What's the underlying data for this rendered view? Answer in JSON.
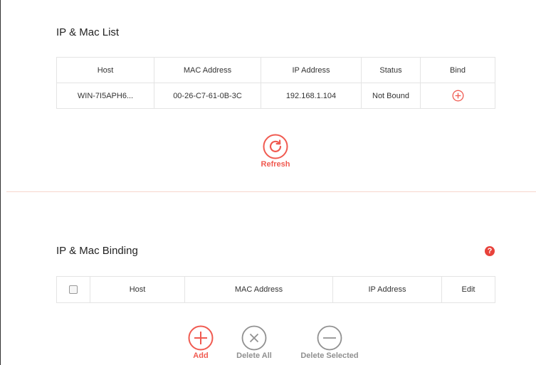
{
  "colors": {
    "accent": "#f05a50",
    "muted": "#909090",
    "divider": "#f7d6cd"
  },
  "ip_mac_list": {
    "title": "IP & Mac List",
    "columns": [
      "Host",
      "MAC Address",
      "IP Address",
      "Status",
      "Bind"
    ],
    "rows": [
      {
        "host": "WIN-7I5APH6...",
        "mac": "00-26-C7-61-0B-3C",
        "ip": "192.168.1.104",
        "status": "Not Bound",
        "bind_icon": "plus-circle-icon"
      }
    ],
    "refresh_label": "Refresh"
  },
  "ip_mac_binding": {
    "title": "IP & Mac Binding",
    "help_icon": "question-circle-icon",
    "help_glyph": "?",
    "columns": [
      "Host",
      "MAC Address",
      "IP Address",
      "Edit"
    ],
    "actions": {
      "add": "Add",
      "delete_all": "Delete All",
      "delete_selected": "Delete Selected"
    }
  }
}
